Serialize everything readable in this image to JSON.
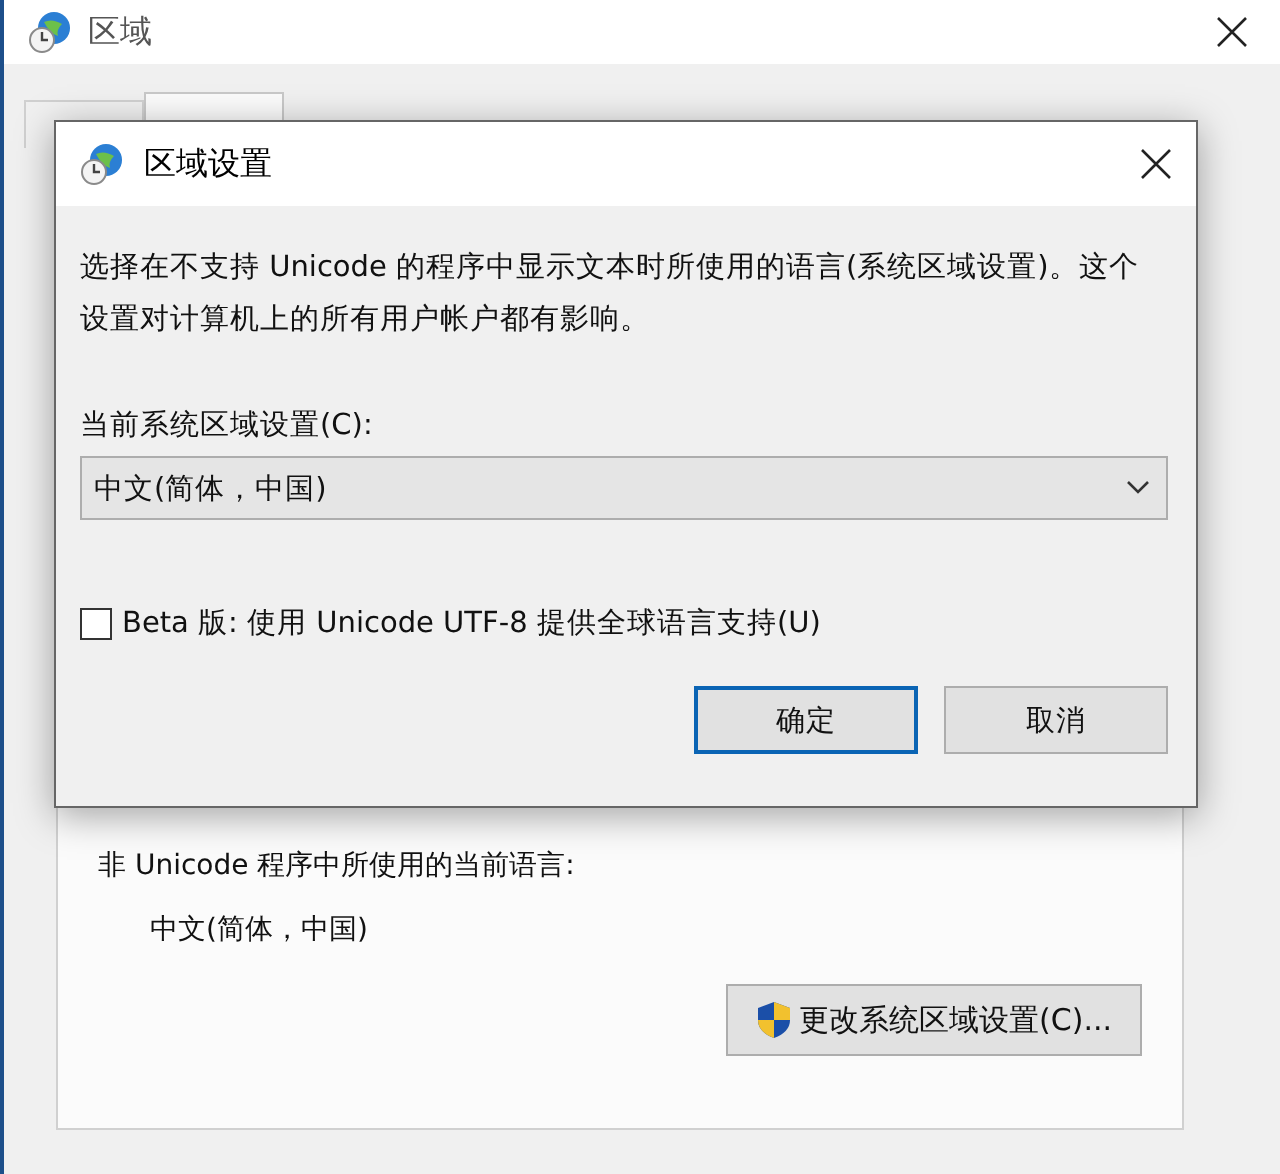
{
  "window": {
    "title": "区域",
    "tabs": [
      {
        "selected": false
      },
      {
        "selected": true
      }
    ],
    "panel": {
      "label": "非 Unicode 程序中所使用的当前语言:",
      "value": "中文(简体，中国)",
      "button": "更改系统区域设置(C)..."
    }
  },
  "dialog": {
    "title": "区域设置",
    "description": "选择在不支持 Unicode 的程序中显示文本时所使用的语言(系统区域设置)。这个设置对计算机上的所有用户帐户都有影响。",
    "locale_label": "当前系统区域设置(C):",
    "locale_value": "中文(简体，中国)",
    "beta": {
      "label": "Beta 版: 使用 Unicode UTF-8 提供全球语言支持(U)",
      "checked": false
    },
    "buttons": [
      {
        "label": "确定",
        "default": true
      },
      {
        "label": "取消",
        "default": false
      }
    ]
  }
}
